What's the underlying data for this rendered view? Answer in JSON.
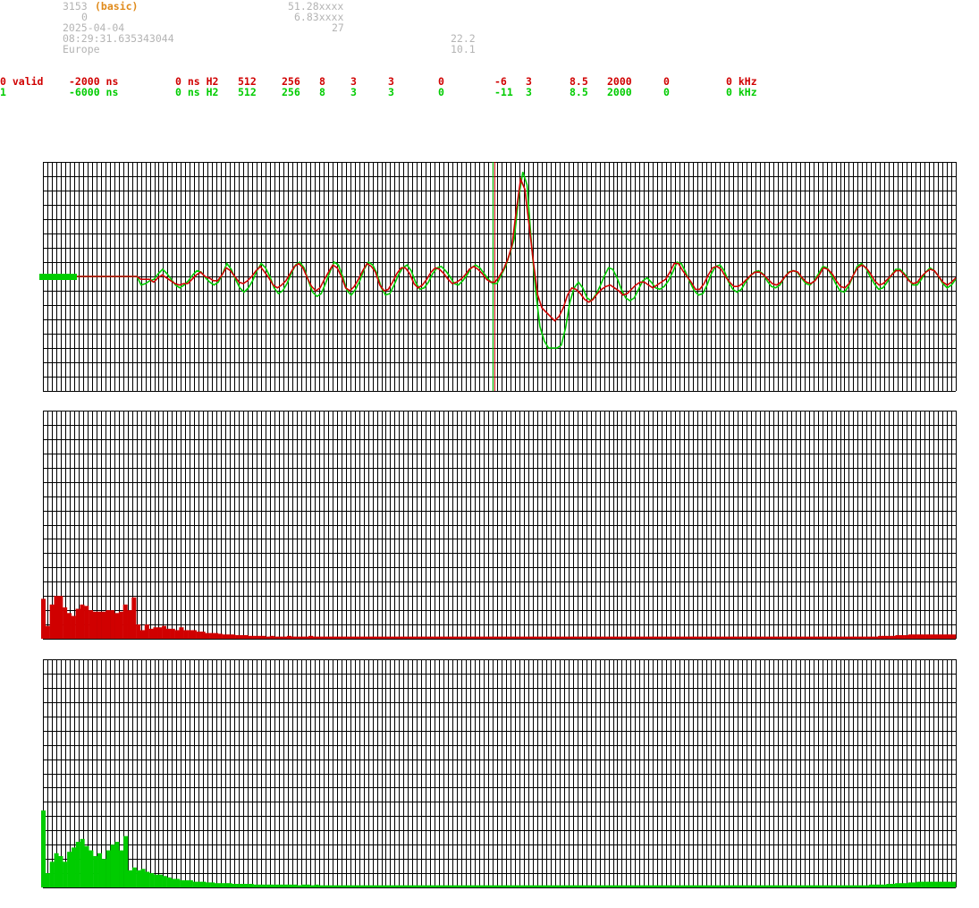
{
  "header": {
    "station_id": "3153",
    "mode": "(basic)",
    "row2_value": "0",
    "date": "2025-04-04",
    "time": "08:29:31.635343044",
    "region": "Europe",
    "lat": "51.28xxxx",
    "lon": "6.83xxxx",
    "count": "27",
    "val_a": "22.2",
    "val_b": "10.1"
  },
  "channels": [
    {
      "cells": [
        "0 valid",
        "-2000 ns",
        "0 ns H2",
        "512",
        "256",
        "8",
        "3",
        "3",
        "0",
        "-6",
        "3",
        "8.5",
        "2000",
        "0",
        "0 kHz"
      ],
      "color": "#d00000"
    },
    {
      "cells": [
        "1",
        "-6000 ns",
        "0 ns H2",
        "512",
        "256",
        "8",
        "3",
        "3",
        "0",
        "-11",
        "3",
        "8.5",
        "2000",
        "0",
        "0 kHz"
      ],
      "color": "#00cc00"
    }
  ],
  "colors": {
    "ch0": "#d00000",
    "ch1": "#00cc00",
    "grid": "#000000",
    "gray_text": "#b4b4b4",
    "accent": "#e08a1a"
  },
  "chart_data": [
    {
      "type": "line",
      "series": [
        {
          "color": "#d00000",
          "values": [
            0,
            0,
            0,
            0,
            0,
            0,
            0,
            0,
            0,
            0,
            0,
            0,
            0,
            0,
            0,
            -0.2,
            -0.2,
            -0.2,
            -0.4,
            -0.1,
            0.1,
            -0.1,
            -0.3,
            -0.5,
            -0.6,
            -0.5,
            -0.5,
            -0.2,
            0.1,
            0.3,
            0.0,
            -0.1,
            -0.3,
            -0.3,
            0.1,
            0.6,
            0.4,
            0.0,
            -0.4,
            -0.5,
            -0.3,
            0.0,
            0.4,
            0.7,
            0.3,
            -0.1,
            -0.6,
            -0.8,
            -0.6,
            -0.3,
            0.2,
            0.7,
            0.9,
            0.6,
            -0.1,
            -0.7,
            -1.0,
            -0.8,
            -0.2,
            0.3,
            0.8,
            0.6,
            0.0,
            -0.8,
            -1.0,
            -0.7,
            -0.2,
            0.4,
            0.9,
            0.7,
            0.3,
            -0.6,
            -1.0,
            -0.9,
            -0.4,
            0.2,
            0.6,
            0.6,
            0.2,
            -0.5,
            -0.8,
            -0.6,
            -0.2,
            0.3,
            0.6,
            0.5,
            0.2,
            -0.2,
            -0.5,
            -0.4,
            -0.2,
            0.1,
            0.5,
            0.7,
            0.5,
            0.2,
            -0.2,
            -0.4,
            -0.4,
            0.0,
            0.5,
            1.2,
            2.2,
            4.6,
            6.8,
            6.1,
            3.6,
            1.0,
            -1.3,
            -2.2,
            -2.5,
            -2.8,
            -3.1,
            -2.8,
            -2.2,
            -1.3,
            -0.8,
            -0.9,
            -1.2,
            -1.6,
            -1.8,
            -1.6,
            -1.2,
            -0.9,
            -0.7,
            -0.6,
            -0.8,
            -1.0,
            -1.3,
            -1.2,
            -0.9,
            -0.6,
            -0.4,
            -0.4,
            -0.6,
            -0.8,
            -0.6,
            -0.4,
            -0.2,
            0.3,
            0.9,
            0.9,
            0.4,
            0.0,
            -0.4,
            -0.9,
            -0.9,
            -0.5,
            0.1,
            0.6,
            0.7,
            0.5,
            0.0,
            -0.4,
            -0.7,
            -0.7,
            -0.5,
            -0.2,
            0.1,
            0.3,
            0.3,
            0.1,
            -0.2,
            -0.5,
            -0.6,
            -0.4,
            0.0,
            0.3,
            0.4,
            0.3,
            -0.1,
            -0.4,
            -0.5,
            -0.3,
            0.1,
            0.6,
            0.5,
            0.2,
            -0.3,
            -0.7,
            -0.8,
            -0.5,
            0.1,
            0.6,
            0.8,
            0.6,
            0.2,
            -0.3,
            -0.6,
            -0.5,
            -0.2,
            0.1,
            0.4,
            0.4,
            0.1,
            -0.3,
            -0.5,
            -0.4,
            0.0,
            0.3,
            0.5,
            0.4,
            0.0,
            -0.4,
            -0.6,
            -0.4,
            -0.1
          ]
        },
        {
          "color": "#00cc00",
          "values": [
            0,
            0,
            0,
            0,
            0,
            0,
            0,
            0,
            0,
            0,
            0,
            0,
            0,
            0,
            0,
            -0.6,
            -0.5,
            -0.3,
            -0.2,
            0.2,
            0.5,
            0.2,
            -0.2,
            -0.6,
            -0.8,
            -0.6,
            -0.3,
            0.1,
            0.4,
            0.3,
            -0.1,
            -0.4,
            -0.6,
            -0.4,
            0.2,
            0.9,
            0.5,
            -0.2,
            -0.8,
            -1.1,
            -0.8,
            -0.3,
            0.4,
            0.9,
            0.6,
            0.0,
            -0.8,
            -1.2,
            -1.0,
            -0.5,
            0.2,
            0.8,
            1.0,
            0.6,
            -0.3,
            -1.1,
            -1.4,
            -1.2,
            -0.5,
            0.3,
            1.0,
            0.8,
            0.0,
            -1.0,
            -1.3,
            -0.9,
            -0.3,
            0.5,
            1.0,
            0.8,
            0.2,
            -0.8,
            -1.3,
            -1.2,
            -0.6,
            0.1,
            0.6,
            0.8,
            0.4,
            -0.4,
            -0.9,
            -0.8,
            -0.4,
            0.2,
            0.6,
            0.7,
            0.4,
            0.0,
            -0.5,
            -0.6,
            -0.3,
            0.1,
            0.6,
            0.8,
            0.6,
            0.2,
            -0.2,
            -0.5,
            -0.5,
            0.1,
            0.7,
            1.6,
            2.6,
            5.4,
            7.3,
            6.4,
            2.4,
            -1.0,
            -3.5,
            -4.5,
            -5.0,
            -5.0,
            -5.0,
            -4.8,
            -3.6,
            -1.8,
            -0.8,
            -0.4,
            -0.8,
            -1.5,
            -1.7,
            -1.3,
            -0.7,
            0.0,
            0.6,
            0.5,
            -0.1,
            -0.9,
            -1.5,
            -1.7,
            -1.5,
            -0.9,
            -0.3,
            -0.1,
            -0.4,
            -0.8,
            -0.9,
            -0.7,
            -0.3,
            0.3,
            1.0,
            0.9,
            0.3,
            -0.4,
            -1.0,
            -1.3,
            -1.2,
            -0.6,
            0.2,
            0.7,
            0.8,
            0.4,
            -0.4,
            -0.9,
            -1.1,
            -0.9,
            -0.4,
            0.0,
            0.3,
            0.4,
            0.2,
            -0.3,
            -0.7,
            -0.8,
            -0.6,
            -0.1,
            0.3,
            0.4,
            0.3,
            -0.1,
            -0.5,
            -0.6,
            -0.3,
            0.2,
            0.7,
            0.6,
            0.1,
            -0.5,
            -1.0,
            -1.1,
            -0.7,
            0.0,
            0.7,
            0.9,
            0.6,
            0.0,
            -0.5,
            -0.9,
            -0.8,
            -0.4,
            0.1,
            0.5,
            0.5,
            0.2,
            -0.2,
            -0.6,
            -0.6,
            -0.2,
            0.3,
            0.6,
            0.4,
            0.0,
            -0.5,
            -0.8,
            -0.6,
            -0.2
          ]
        }
      ],
      "ylim": [
        -8,
        8
      ],
      "markers": [
        0.493,
        0.495
      ],
      "grid": true
    },
    {
      "type": "bar",
      "color": "#d00000",
      "values": [
        2.8,
        0.9,
        2.4,
        3.0,
        3.0,
        2.2,
        1.8,
        1.6,
        2.1,
        2.4,
        2.3,
        2.0,
        1.9,
        1.9,
        1.9,
        2.0,
        2.0,
        1.8,
        1.9,
        2.4,
        2.0,
        2.9,
        1.0,
        0.6,
        1.0,
        0.7,
        0.8,
        0.8,
        0.9,
        0.7,
        0.7,
        0.6,
        0.8,
        0.6,
        0.6,
        0.6,
        0.5,
        0.5,
        0.4,
        0.4,
        0.4,
        0.35,
        0.3,
        0.3,
        0.3,
        0.25,
        0.25,
        0.25,
        0.2,
        0.2,
        0.2,
        0.2,
        0.15,
        0.2,
        0.15,
        0.15,
        0.15,
        0.2,
        0.15,
        0.15,
        0.15,
        0.15,
        0.2,
        0.15,
        0.15,
        0.15,
        0.15,
        0.15,
        0.15,
        0.15,
        0.15,
        0.15,
        0.15,
        0.15,
        0.15,
        0.15,
        0.15,
        0.15,
        0.15,
        0.15,
        0.15,
        0.15,
        0.15,
        0.15,
        0.15,
        0.15,
        0.15,
        0.15,
        0.15,
        0.15,
        0.15,
        0.15,
        0.15,
        0.15,
        0.15,
        0.15,
        0.15,
        0.15,
        0.15,
        0.15,
        0.15,
        0.15,
        0.15,
        0.15,
        0.15,
        0.15,
        0.15,
        0.15,
        0.15,
        0.15,
        0.15,
        0.15,
        0.15,
        0.15,
        0.15,
        0.15,
        0.15,
        0.15,
        0.15,
        0.15,
        0.15,
        0.15,
        0.15,
        0.15,
        0.15,
        0.15,
        0.15,
        0.15,
        0.15,
        0.15,
        0.15,
        0.15,
        0.15,
        0.15,
        0.15,
        0.15,
        0.15,
        0.15,
        0.15,
        0.15,
        0.15,
        0.15,
        0.15,
        0.15,
        0.15,
        0.15,
        0.15,
        0.15,
        0.15,
        0.15,
        0.15,
        0.15,
        0.15,
        0.15,
        0.15,
        0.15,
        0.15,
        0.15,
        0.15,
        0.15,
        0.15,
        0.15,
        0.15,
        0.15,
        0.15,
        0.15,
        0.15,
        0.15,
        0.15,
        0.15,
        0.15,
        0.15,
        0.15,
        0.15,
        0.15,
        0.15,
        0.15,
        0.15,
        0.15,
        0.15,
        0.15,
        0.15,
        0.15,
        0.15,
        0.15,
        0.15,
        0.15,
        0.15,
        0.15,
        0.15,
        0.15,
        0.15,
        0.15,
        0.15,
        0.2,
        0.2,
        0.2,
        0.2,
        0.25,
        0.25,
        0.25,
        0.3,
        0.3,
        0.3,
        0.3,
        0.3,
        0.3,
        0.3,
        0.3,
        0.3,
        0.3,
        0.3
      ],
      "ylim": [
        0,
        16
      ],
      "grid": true
    },
    {
      "type": "bar",
      "color": "#00cc00",
      "values": [
        5.4,
        1.0,
        1.8,
        2.4,
        2.2,
        1.8,
        2.5,
        2.8,
        3.2,
        3.4,
        2.9,
        2.6,
        2.2,
        2.4,
        2.0,
        2.6,
        3.0,
        3.2,
        2.6,
        3.6,
        1.2,
        1.4,
        1.2,
        1.3,
        1.1,
        1.0,
        0.9,
        0.9,
        0.8,
        0.7,
        0.6,
        0.6,
        0.5,
        0.5,
        0.5,
        0.4,
        0.4,
        0.4,
        0.35,
        0.35,
        0.3,
        0.3,
        0.3,
        0.3,
        0.25,
        0.25,
        0.25,
        0.25,
        0.25,
        0.2,
        0.2,
        0.2,
        0.2,
        0.2,
        0.2,
        0.2,
        0.2,
        0.2,
        0.2,
        0.15,
        0.2,
        0.2,
        0.15,
        0.2,
        0.15,
        0.15,
        0.15,
        0.15,
        0.15,
        0.15,
        0.15,
        0.15,
        0.15,
        0.15,
        0.15,
        0.15,
        0.15,
        0.15,
        0.15,
        0.15,
        0.15,
        0.15,
        0.15,
        0.15,
        0.15,
        0.15,
        0.15,
        0.15,
        0.15,
        0.15,
        0.15,
        0.15,
        0.15,
        0.15,
        0.15,
        0.15,
        0.15,
        0.15,
        0.15,
        0.15,
        0.15,
        0.15,
        0.15,
        0.15,
        0.15,
        0.15,
        0.15,
        0.15,
        0.15,
        0.15,
        0.15,
        0.15,
        0.15,
        0.15,
        0.15,
        0.15,
        0.15,
        0.15,
        0.15,
        0.15,
        0.15,
        0.15,
        0.15,
        0.15,
        0.15,
        0.15,
        0.15,
        0.15,
        0.15,
        0.15,
        0.15,
        0.15,
        0.15,
        0.15,
        0.15,
        0.15,
        0.15,
        0.15,
        0.15,
        0.15,
        0.15,
        0.15,
        0.15,
        0.15,
        0.15,
        0.15,
        0.15,
        0.15,
        0.15,
        0.15,
        0.15,
        0.15,
        0.15,
        0.15,
        0.15,
        0.15,
        0.15,
        0.15,
        0.15,
        0.15,
        0.15,
        0.15,
        0.15,
        0.15,
        0.15,
        0.15,
        0.15,
        0.15,
        0.15,
        0.15,
        0.15,
        0.15,
        0.15,
        0.15,
        0.15,
        0.15,
        0.15,
        0.15,
        0.15,
        0.15,
        0.15,
        0.15,
        0.15,
        0.15,
        0.15,
        0.15,
        0.15,
        0.15,
        0.15,
        0.15,
        0.15,
        0.2,
        0.2,
        0.2,
        0.2,
        0.25,
        0.25,
        0.3,
        0.3,
        0.3,
        0.35,
        0.35,
        0.4,
        0.4,
        0.4,
        0.4,
        0.4,
        0.4,
        0.4,
        0.4,
        0.4
      ],
      "ylim": [
        0,
        16
      ],
      "grid": true
    }
  ]
}
